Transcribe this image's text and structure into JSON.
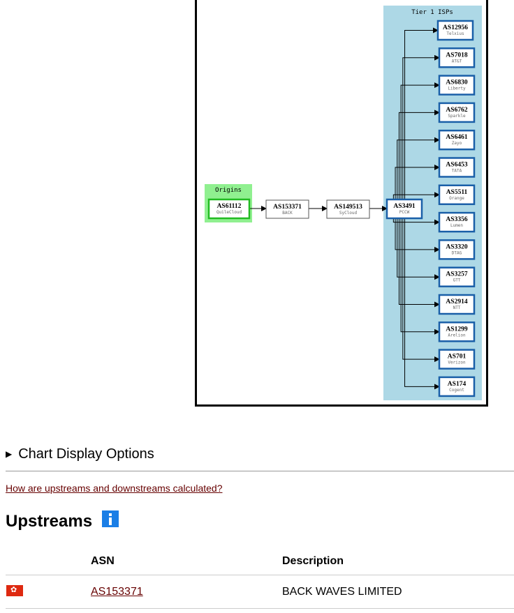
{
  "graph": {
    "origins_label": "Origins",
    "tier1_label": "Tier 1 ISPs",
    "origin": {
      "asn": "AS61112",
      "name": "QuileCloud"
    },
    "chain": [
      {
        "asn": "AS153371",
        "name": "BACK"
      },
      {
        "asn": "AS149513",
        "name": "SyCloud"
      },
      {
        "asn": "AS3491",
        "name": "PCCW"
      }
    ],
    "tier1": [
      {
        "asn": "AS12956",
        "name": "Telxius"
      },
      {
        "asn": "AS7018",
        "name": "AT&T"
      },
      {
        "asn": "AS6830",
        "name": "Liberty"
      },
      {
        "asn": "AS6762",
        "name": "Sparkle"
      },
      {
        "asn": "AS6461",
        "name": "Zayo"
      },
      {
        "asn": "AS6453",
        "name": "TATA"
      },
      {
        "asn": "AS5511",
        "name": "Orange"
      },
      {
        "asn": "AS3356",
        "name": "Lumen"
      },
      {
        "asn": "AS3320",
        "name": "DTAG"
      },
      {
        "asn": "AS3257",
        "name": "GTT"
      },
      {
        "asn": "AS2914",
        "name": "NTT"
      },
      {
        "asn": "AS1299",
        "name": "Arelion"
      },
      {
        "asn": "AS701",
        "name": "Verizon"
      },
      {
        "asn": "AS174",
        "name": "Cogent"
      }
    ],
    "colors": {
      "origin_fill": "#90f090",
      "origin_border": "#22bb22",
      "tier1_bg": "#add8e6",
      "tier1_border": "#1a5fa8"
    }
  },
  "options": {
    "label": "Chart Display Options",
    "toggle_icon": "triangle-right-icon"
  },
  "help_link": "How are upstreams and downstreams calculated?",
  "upstreams": {
    "title": "Upstreams",
    "info_icon": "info-icon",
    "columns": {
      "asn": "ASN",
      "description": "Description"
    },
    "rows": [
      {
        "flag": "hong-kong-flag",
        "asn": "AS153371",
        "description": "BACK WAVES LIMITED"
      }
    ]
  },
  "accent_colors": {
    "link": "#660000",
    "info": "#1a7ee6",
    "flag": "#de2910"
  }
}
